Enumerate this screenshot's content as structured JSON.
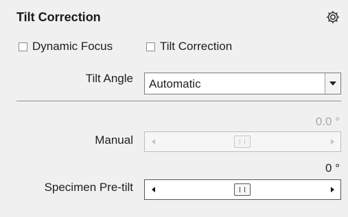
{
  "panel": {
    "title": "Tilt Correction",
    "settings_icon": "gear-molecule-icon"
  },
  "options": {
    "dynamic_focus": {
      "label": "Dynamic Focus",
      "checked": false
    },
    "tilt_correction": {
      "label": "Tilt Correction",
      "checked": false
    }
  },
  "tilt_angle": {
    "label": "Tilt Angle",
    "selected": "Automatic"
  },
  "manual": {
    "label": "Manual",
    "value_text": "0.0 °",
    "enabled": false,
    "position": 0.5
  },
  "pretilt": {
    "label": "Specimen Pre-tilt",
    "value_text": "0 °",
    "enabled": true,
    "position": 0.5
  }
}
